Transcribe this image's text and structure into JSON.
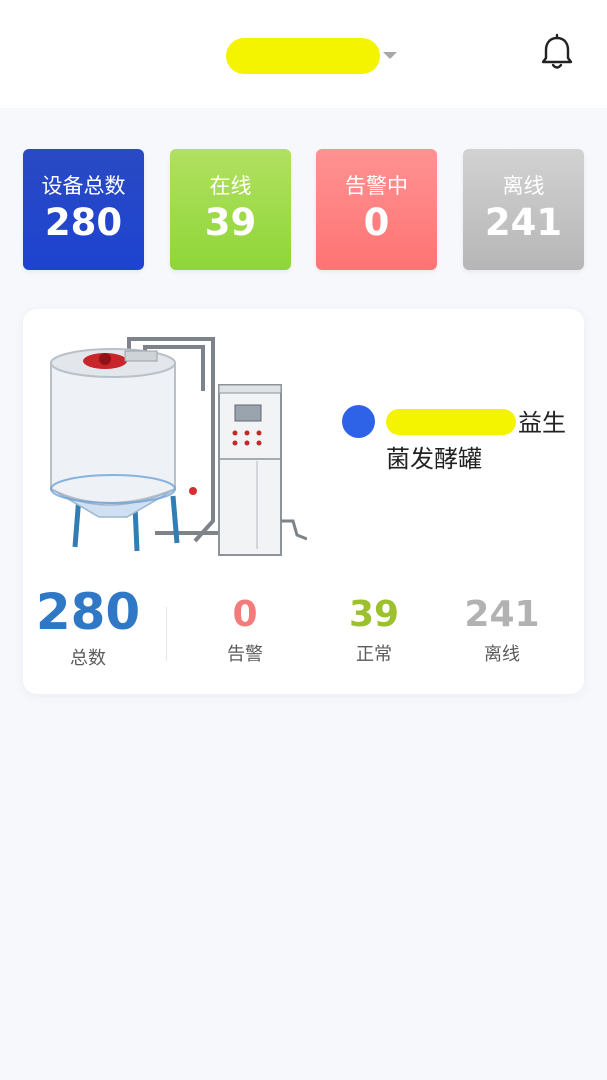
{
  "header": {
    "title_redaction_color": "#f4f400",
    "caret_icon": "caret-down-icon",
    "notification_icon": "bell-icon"
  },
  "stats": {
    "total": {
      "label": "设备总数",
      "value": "280",
      "color": "#1d43d0"
    },
    "online": {
      "label": "在线",
      "value": "39",
      "color": "#8ed638"
    },
    "alarm": {
      "label": "告警中",
      "value": "0",
      "color": "#ff7373"
    },
    "offline": {
      "label": "离线",
      "value": "241",
      "color": "#b6b6b6"
    }
  },
  "device": {
    "image_icon": "fermentation-tank-image",
    "status_color": "#2e63e8",
    "name_visible": "益生菌发酵罐",
    "name_line1_tail": "益",
    "name_line2": "生菌发酵罐",
    "summary": {
      "total": {
        "value": "280",
        "label": "总数",
        "color": "#2f78c6"
      },
      "alarm": {
        "value": "0",
        "label": "告警",
        "color": "#f47b7b"
      },
      "normal": {
        "value": "39",
        "label": "正常",
        "color": "#9cc02e"
      },
      "offline": {
        "value": "241",
        "label": "离线",
        "color": "#b2b2b2"
      }
    }
  }
}
